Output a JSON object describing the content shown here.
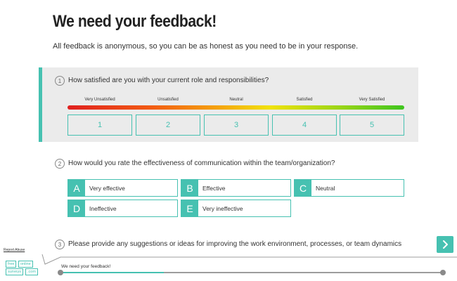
{
  "header": {
    "title": "We need your feedback!",
    "subtitle": "All feedback is anonymous, so you can be as honest as you need to be in your response."
  },
  "q1": {
    "number": "1",
    "text": "How satisfied are you with your current role and responsibilities?",
    "scale_labels": [
      "Very Unsatisfied",
      "Unsatisfied",
      "Neutral",
      "Satisfied",
      "Very Satisfied"
    ],
    "buttons": [
      "1",
      "2",
      "3",
      "4",
      "5"
    ]
  },
  "q2": {
    "number": "2",
    "text": "How would you rate the effectiveness of communication within the team/organization?",
    "options": [
      {
        "letter": "A",
        "label": "Very effective"
      },
      {
        "letter": "B",
        "label": "Effective"
      },
      {
        "letter": "C",
        "label": "Neutral"
      },
      {
        "letter": "D",
        "label": "Ineffective"
      },
      {
        "letter": "E",
        "label": "Very ineffective"
      }
    ]
  },
  "q3": {
    "number": "3",
    "text": "Please provide any suggestions or ideas for improving the work environment, processes, or team dynamics"
  },
  "footer": {
    "report_abuse": "Report Abuse",
    "logo": {
      "line1a": "free",
      "line1b": "online",
      "line2a": "surveys",
      "line2b": ".com"
    },
    "survey_title": "We need your feedback!",
    "progress": 0.27
  },
  "colors": {
    "accent": "#46c1b1",
    "card_bg": "#ebebeb"
  },
  "icons": {
    "next": "chevron-right-icon"
  }
}
